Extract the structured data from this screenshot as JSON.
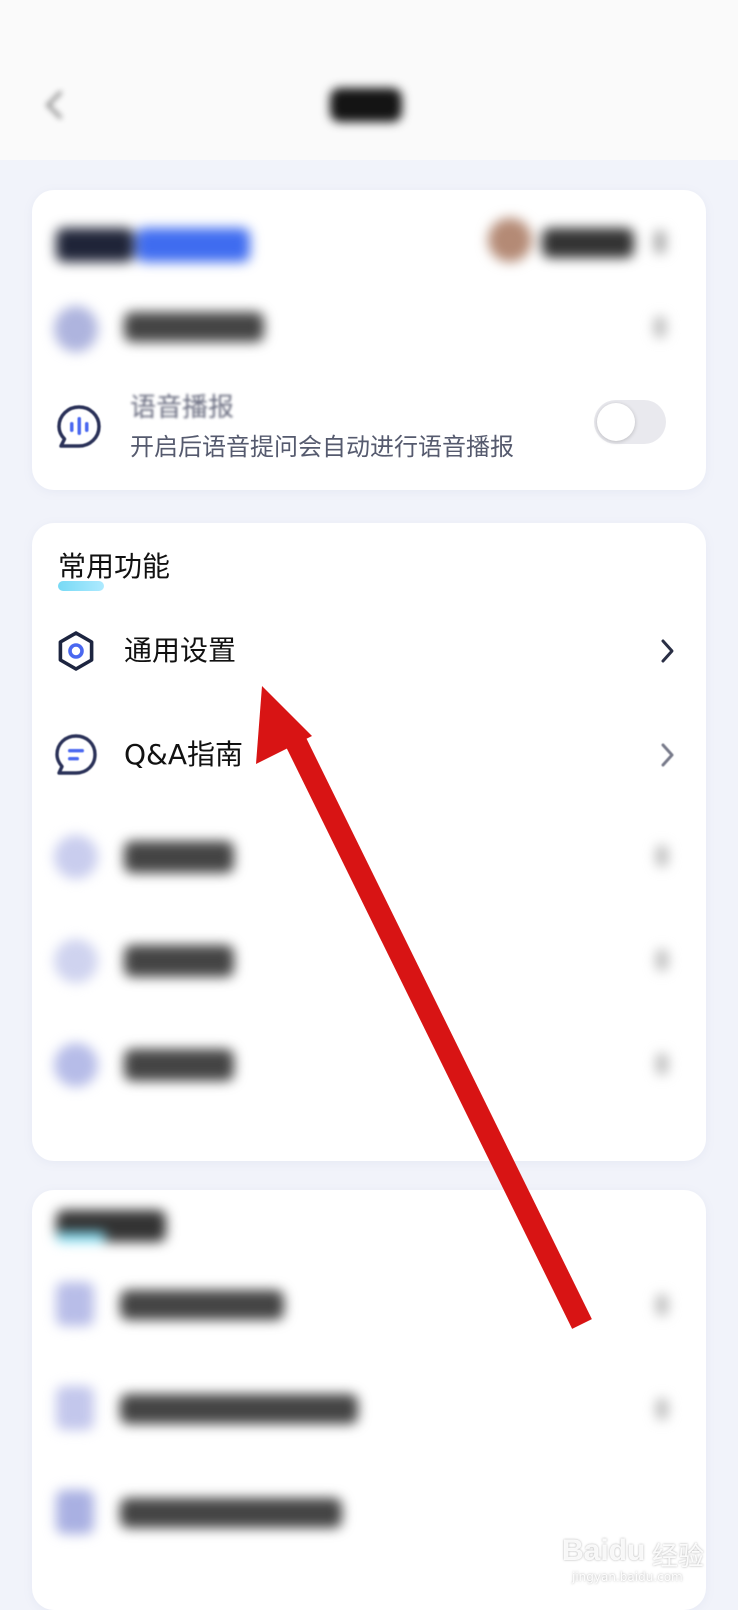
{
  "voice": {
    "title": "语音播报",
    "subtitle": "开启后语音提问会自动进行语音播报",
    "enabled": false
  },
  "features": {
    "title": "常用功能",
    "items": [
      {
        "label": "通用设置"
      },
      {
        "label": "Q&A指南"
      }
    ]
  },
  "watermark": {
    "brand": "Baidu",
    "cn": "经验",
    "url": "jingyan.baidu.com"
  },
  "colors": {
    "accent": "#4a68f0",
    "arrow": "#d81414",
    "icon_dark": "#1d2540"
  }
}
